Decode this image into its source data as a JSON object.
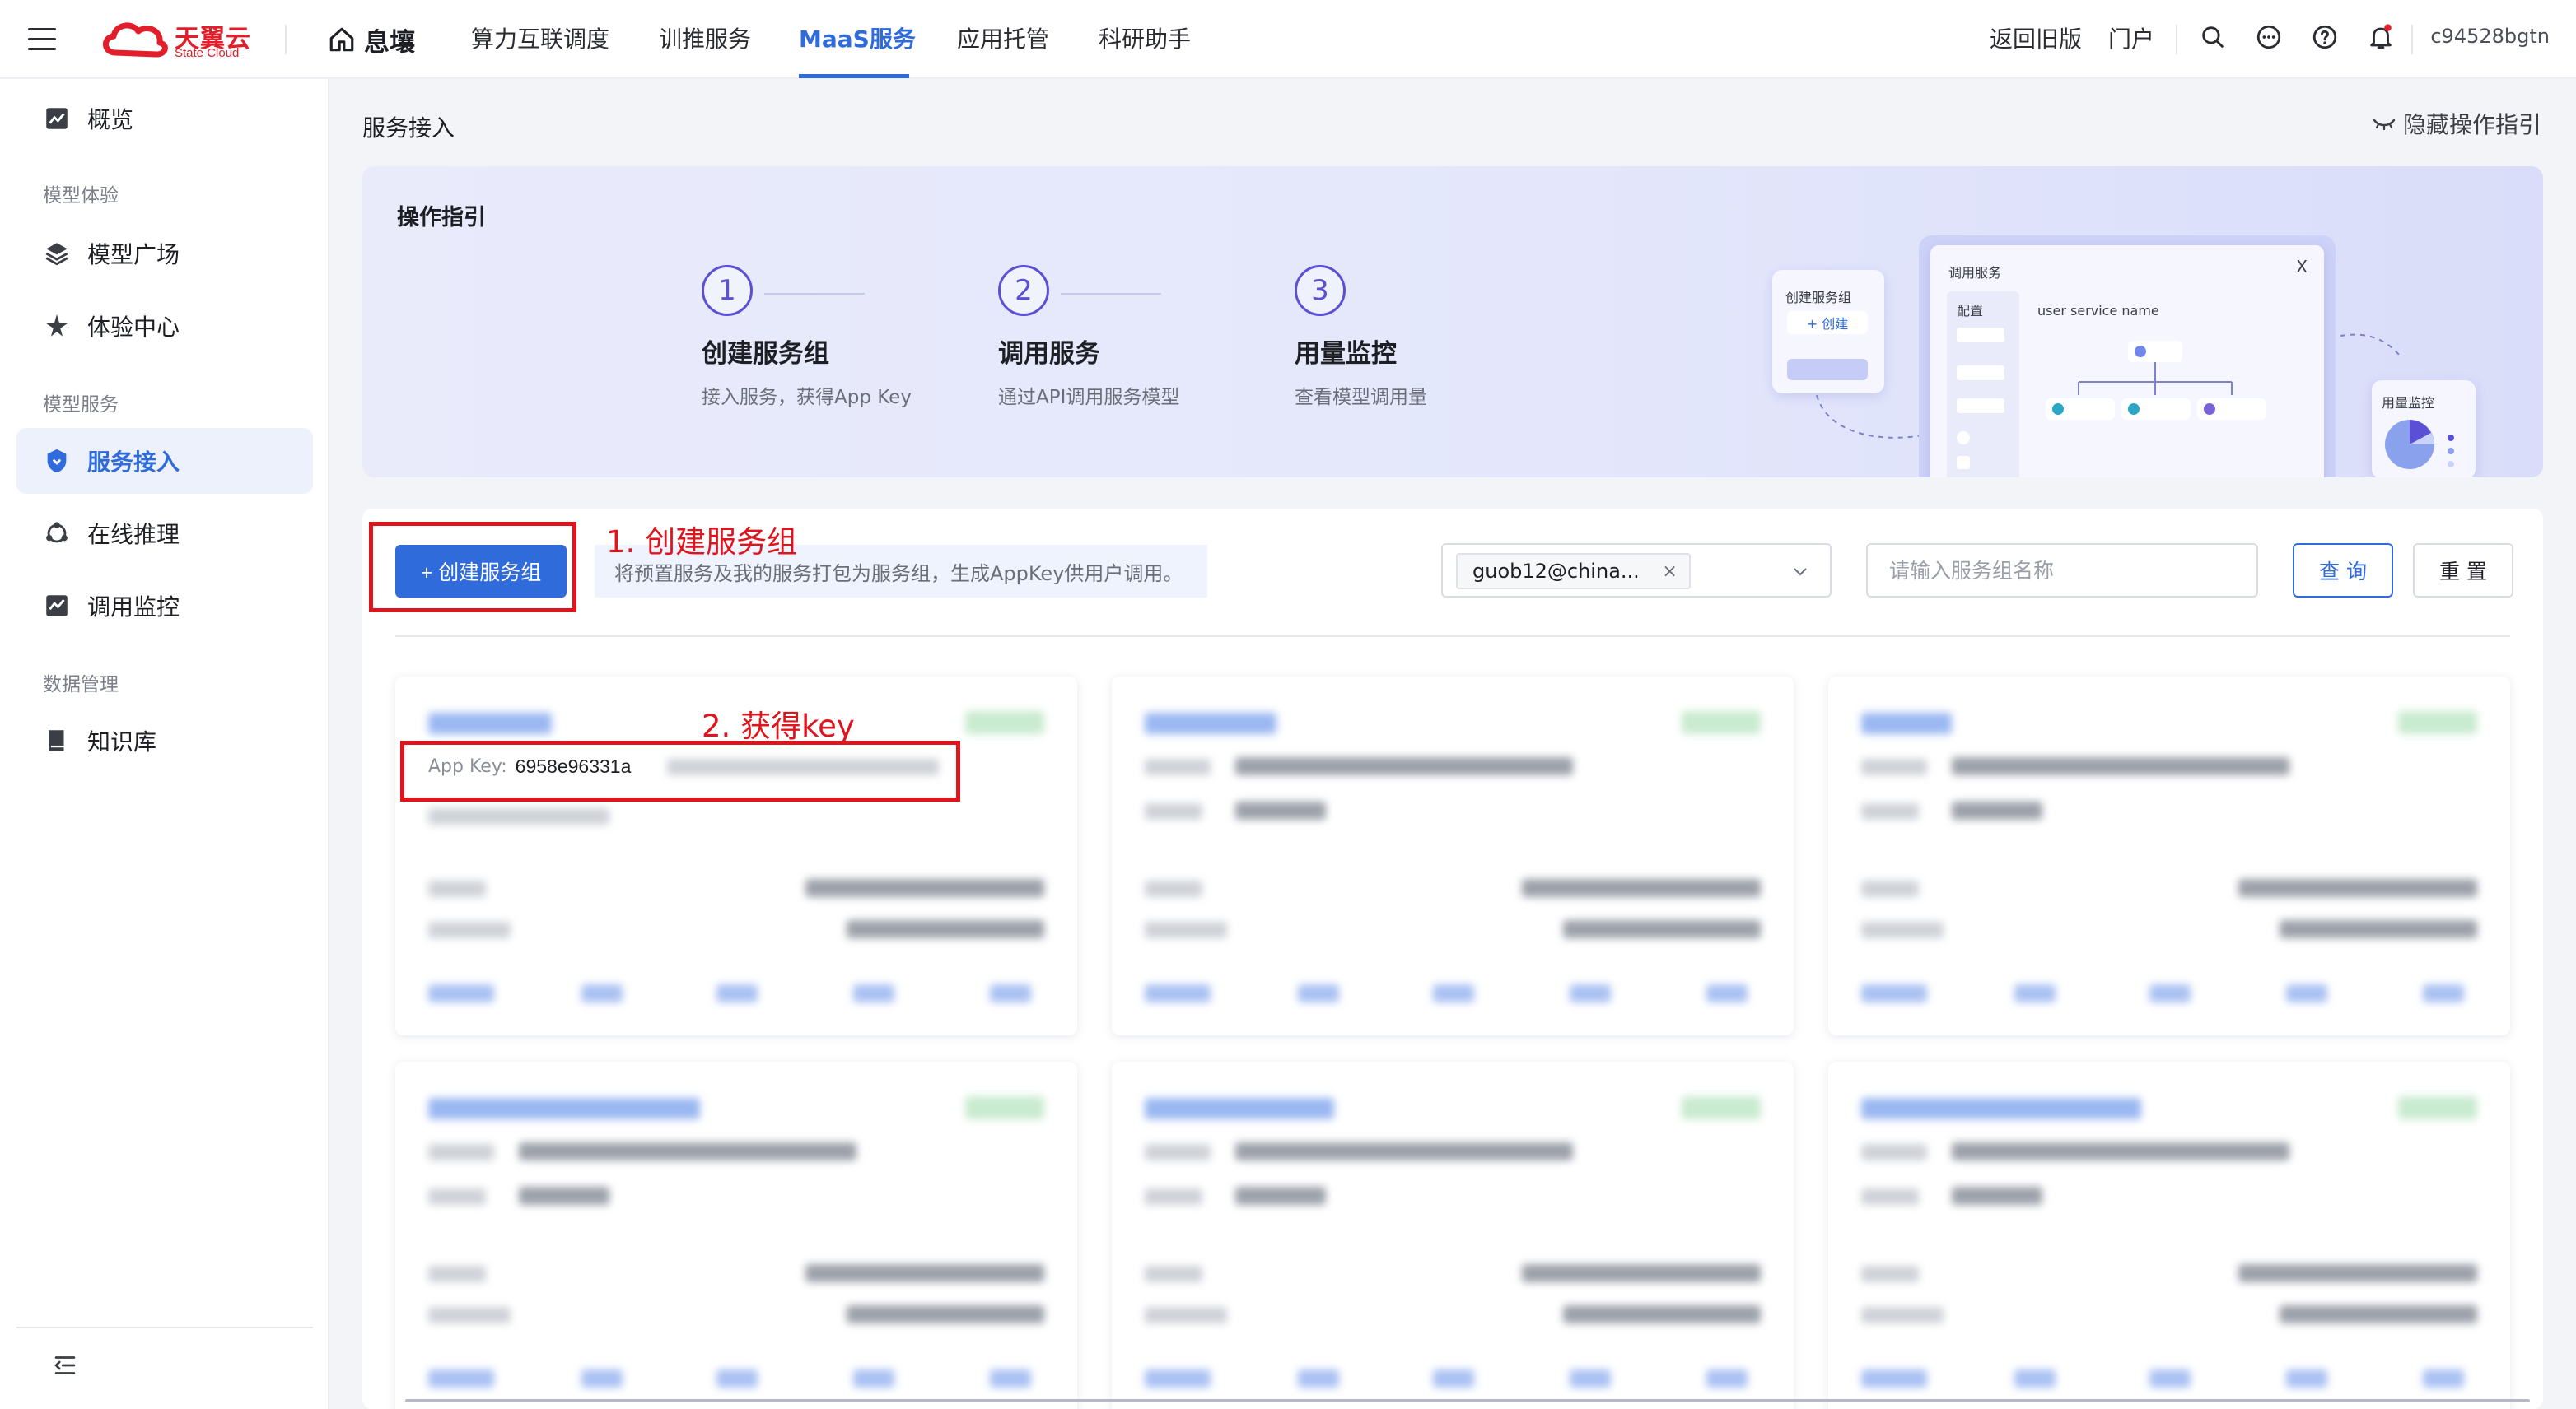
{
  "brand": {
    "name_cn": "天翼云",
    "name_en": "State Cloud",
    "color": "#e11e2a"
  },
  "accent_color": "#2f6bdb",
  "topnav": {
    "home_label": "息壤",
    "items": [
      {
        "label": "算力互联调度"
      },
      {
        "label": "训推服务"
      },
      {
        "label": "MaaS服务",
        "active": true
      },
      {
        "label": "应用托管"
      },
      {
        "label": "科研助手"
      }
    ],
    "right": {
      "old_version": "返回旧版",
      "portal": "门户",
      "username": "c94528bgtn"
    },
    "icons": [
      "search-icon",
      "chat-icon",
      "help-icon",
      "bell-icon"
    ]
  },
  "sidebar": {
    "top_item": {
      "label": "概览",
      "icon": "chart-icon"
    },
    "groups": [
      {
        "title": "模型体验",
        "items": [
          {
            "label": "模型广场",
            "icon": "layers-icon"
          },
          {
            "label": "体验中心",
            "icon": "star-cluster-icon"
          }
        ]
      },
      {
        "title": "模型服务",
        "items": [
          {
            "label": "服务接入",
            "icon": "shield-icon",
            "active": true
          },
          {
            "label": "在线推理",
            "icon": "network-icon"
          },
          {
            "label": "调用监控",
            "icon": "monitor-icon"
          }
        ]
      },
      {
        "title": "数据管理",
        "items": [
          {
            "label": "知识库",
            "icon": "book-icon"
          }
        ]
      }
    ]
  },
  "page": {
    "breadcrumb": "服务接入",
    "hide_guide": "隐藏操作指引"
  },
  "guide": {
    "title": "操作指引",
    "steps": [
      {
        "num": "1",
        "title": "创建服务组",
        "desc": "接入服务，获得App Key"
      },
      {
        "num": "2",
        "title": "调用服务",
        "desc": "通过API调用服务模型"
      },
      {
        "num": "3",
        "title": "用量监控",
        "desc": "查看模型调用量"
      }
    ],
    "illustration": {
      "create_card_title": "创建服务组",
      "create_card_btn": "+ 创建",
      "main_card_title": "调用服务",
      "main_card_close": "X",
      "config_label": "配置",
      "service_name": "user service name",
      "monitor_title": "用量监控"
    }
  },
  "toolbar": {
    "create_label": "+ 创建服务组",
    "create_tip": "将预置服务及我的服务打包为服务组，生成AppKey供用户调用。",
    "owner_tag": "guob12@china...",
    "search_placeholder": "请输入服务组名称",
    "query_label": "查 询",
    "reset_label": "重 置"
  },
  "card": {
    "appkey_label": "App Key:",
    "appkey_value_visible": "6958e96331a"
  },
  "annotations": {
    "step1": "1. 创建服务组",
    "step2": "2. 获得key"
  }
}
